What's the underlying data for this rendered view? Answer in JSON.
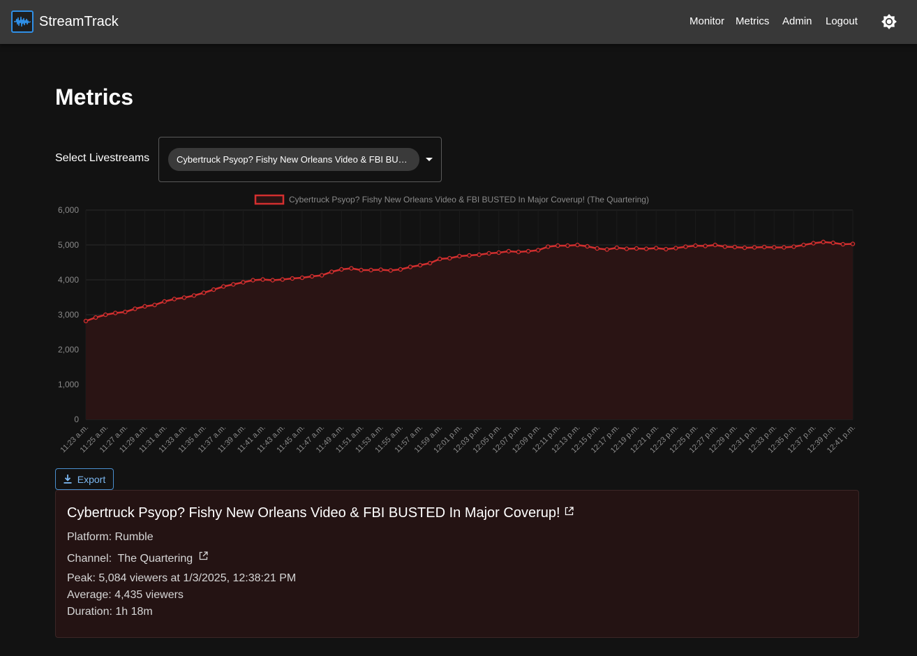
{
  "app": {
    "name": "StreamTrack",
    "logo_icon": "waveform-icon"
  },
  "nav": {
    "monitor": "Monitor",
    "metrics": "Metrics",
    "admin": "Admin",
    "logout": "Logout",
    "theme_icon": "brightness-icon"
  },
  "page": {
    "title": "Metrics"
  },
  "selector": {
    "label": "Select Livestreams",
    "selected_chip": "Cybertruck Psyop? Fishy New Orleans Video & FBI BUSTED In Major Coverup! (The Quartering)"
  },
  "export": {
    "label": "Export",
    "icon": "download-icon"
  },
  "stream": {
    "title": "Cybertruck Psyop? Fishy New Orleans Video & FBI BUSTED In Major Coverup!",
    "platform_label": "Platform:",
    "platform": "Rumble",
    "channel_label": "Channel:",
    "channel": "The Quartering",
    "peak": "Peak: 5,084 viewers at 1/3/2025, 12:38:21 PM",
    "average": "Average: 4,435 viewers",
    "duration": "Duration: 1h 18m"
  },
  "colors": {
    "series": "#d32f2f",
    "fill": "#2a1414",
    "accent": "#2f8fe6"
  },
  "chart_data": {
    "type": "area",
    "legend": [
      "Cybertruck Psyop? Fishy New Orleans Video & FBI BUSTED In Major Coverup! (The Quartering)"
    ],
    "legend_position": "top",
    "ylim": [
      0,
      6000
    ],
    "yticks": [
      "0",
      "1,000",
      "2,000",
      "3,000",
      "4,000",
      "5,000",
      "6,000"
    ],
    "xticks": [
      "11:23 a.m.",
      "11:25 a.m.",
      "11:27 a.m.",
      "11:29 a.m.",
      "11:31 a.m.",
      "11:33 a.m.",
      "11:35 a.m.",
      "11:37 a.m.",
      "11:39 a.m.",
      "11:41 a.m.",
      "11:43 a.m.",
      "11:45 a.m.",
      "11:47 a.m.",
      "11:49 a.m.",
      "11:51 a.m.",
      "11:53 a.m.",
      "11:55 a.m.",
      "11:57 a.m.",
      "11:59 a.m.",
      "12:01 p.m.",
      "12:03 p.m.",
      "12:05 p.m.",
      "12:07 p.m.",
      "12:09 p.m.",
      "12:11 p.m.",
      "12:13 p.m.",
      "12:15 p.m.",
      "12:17 p.m.",
      "12:19 p.m.",
      "12:21 p.m.",
      "12:23 p.m.",
      "12:25 p.m.",
      "12:27 p.m.",
      "12:29 p.m.",
      "12:31 p.m.",
      "12:33 p.m.",
      "12:35 p.m.",
      "12:37 p.m.",
      "12:39 p.m.",
      "12:41 p.m."
    ],
    "series": [
      {
        "name": "Cybertruck Psyop? Fishy New Orleans Video & FBI BUSTED In Major Coverup! (The Quartering)",
        "values": [
          2820,
          2920,
          3000,
          3050,
          3080,
          3170,
          3240,
          3280,
          3380,
          3450,
          3490,
          3550,
          3630,
          3720,
          3810,
          3870,
          3930,
          3990,
          4010,
          3990,
          4010,
          4040,
          4060,
          4100,
          4130,
          4230,
          4300,
          4330,
          4280,
          4280,
          4290,
          4270,
          4300,
          4370,
          4420,
          4480,
          4600,
          4620,
          4680,
          4700,
          4720,
          4760,
          4780,
          4820,
          4800,
          4820,
          4850,
          4950,
          4980,
          4980,
          5000,
          4960,
          4900,
          4870,
          4920,
          4890,
          4900,
          4890,
          4910,
          4880,
          4910,
          4950,
          4980,
          4970,
          5000,
          4950,
          4940,
          4920,
          4930,
          4940,
          4930,
          4930,
          4950,
          5000,
          5050,
          5084,
          5060,
          5020,
          5030
        ]
      }
    ]
  }
}
